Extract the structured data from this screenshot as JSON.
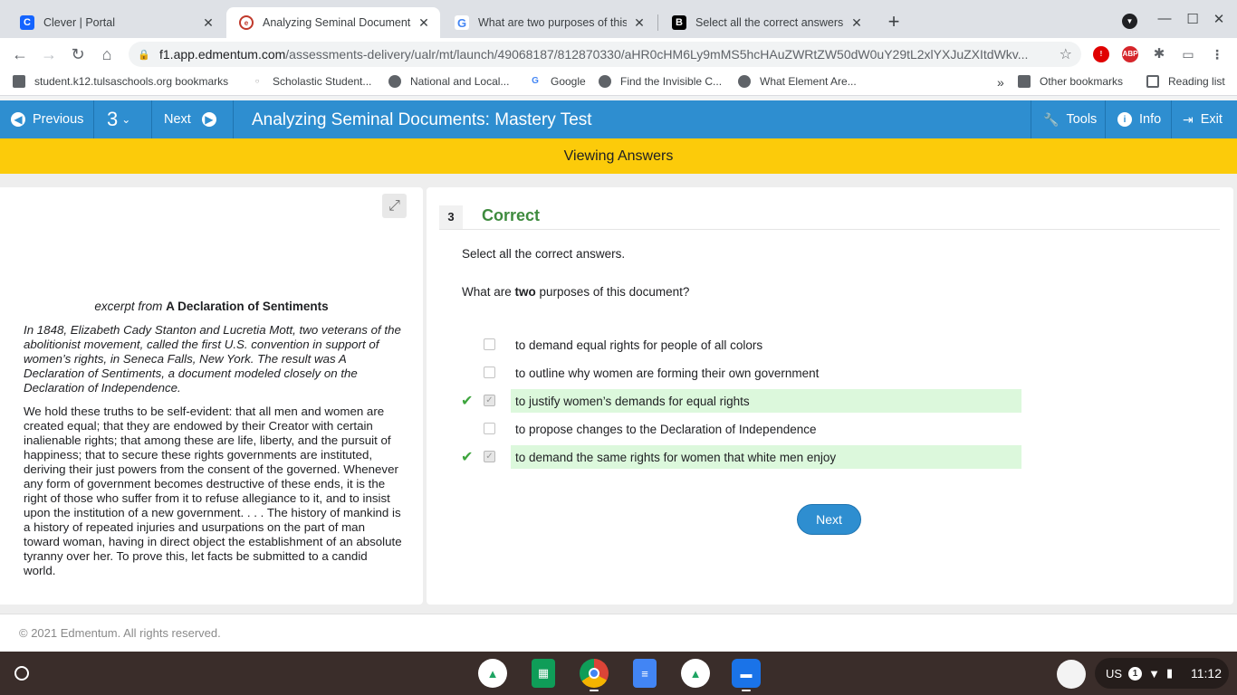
{
  "browser": {
    "tabs": [
      {
        "title": "Clever | Portal",
        "favicon": "C"
      },
      {
        "title": "Analyzing Seminal Documents: M",
        "favicon": "e"
      },
      {
        "title": "What are two purposes of this do",
        "favicon": "G"
      },
      {
        "title": "Select all the correct answers. Wh",
        "favicon": "B"
      }
    ],
    "url_host": "f1.app.edmentum.com",
    "url_path": "/assessments-delivery/ualr/mt/launch/49068187/812870330/aHR0cHM6Ly9mMS5hcHAuZWRtZW50dW0uY29tL2xlYXJuZXItdWkv...",
    "extensions": [
      "ABP"
    ]
  },
  "bookmarks": {
    "items": [
      "student.k12.tulsaschools.org bookmarks",
      "Scholastic Student...",
      "National and Local...",
      "Google",
      "Find the Invisible C...",
      "What Element Are..."
    ],
    "overflow": "»",
    "other": "Other bookmarks",
    "reading_list": "Reading list"
  },
  "header": {
    "previous": "Previous",
    "question_number": "3",
    "next": "Next",
    "title": "Analyzing Seminal Documents: Mastery Test",
    "tools": "Tools",
    "info": "Info",
    "exit": "Exit"
  },
  "banner": "Viewing Answers",
  "passage": {
    "prefix": "excerpt from ",
    "title": "A Declaration of Sentiments",
    "intro": "In 1848, Elizabeth Cady Stanton and Lucretia Mott, two veterans of the abolitionist movement, called the first U.S. convention in support of women’s rights, in Seneca Falls, New York. The result was A Declaration of Sentiments, a document modeled closely on the Declaration of Independence.",
    "body": "We hold these truths to be self-evident: that all men and women are created equal; that they are endowed by their Creator with certain inalienable rights; that among these are life, liberty, and the pursuit of happiness; that to secure these rights governments are instituted, deriving their just powers from the consent of the governed. Whenever any form of government becomes destructive of these ends, it is the right of those who suffer from it to refuse allegiance to it, and to insist upon the institution of a new government. . . . The history of mankind is a history of repeated injuries and usurpations on the part of man toward woman, having in direct object the establishment of an absolute tyranny over her. To prove this, let facts be submitted to a candid world."
  },
  "question": {
    "number": "3",
    "status": "Correct",
    "instruction": "Select all the correct answers.",
    "prompt_before": "What are ",
    "prompt_bold": "two",
    "prompt_after": " purposes of this document?",
    "options": [
      {
        "text": "to demand equal rights for people of all colors",
        "checked": false,
        "correct": false
      },
      {
        "text": "to outline why women are forming their own government",
        "checked": false,
        "correct": false
      },
      {
        "text": "to justify women’s demands for equal rights",
        "checked": true,
        "correct": true
      },
      {
        "text": "to propose changes to the Declaration of Independence",
        "checked": false,
        "correct": false
      },
      {
        "text": "to demand the same rights for women that white men enjoy",
        "checked": true,
        "correct": true
      }
    ],
    "next_label": "Next"
  },
  "footer": "© 2021 Edmentum. All rights reserved.",
  "shelf": {
    "ime": "US",
    "notifications": "1",
    "time": "11:12"
  },
  "colors": {
    "header_blue": "#2e8ed0",
    "banner_yellow": "#fccb0a",
    "correct_green": "#3e8b3e",
    "correct_bg": "#dcf8dc"
  }
}
